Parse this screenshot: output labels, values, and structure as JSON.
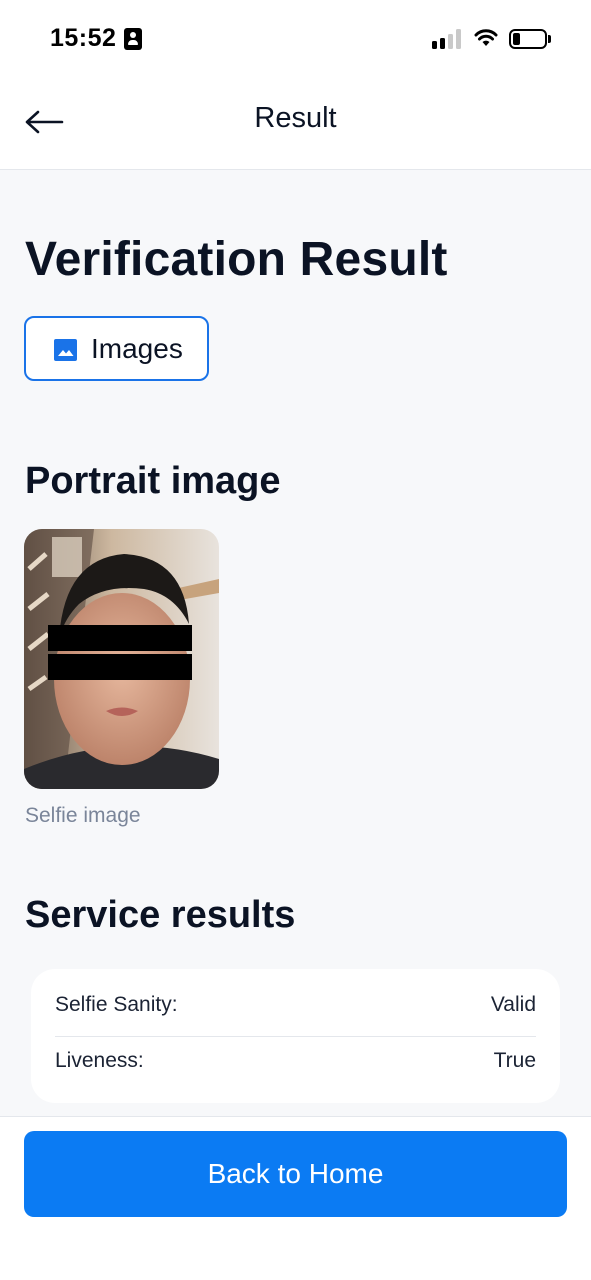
{
  "status_bar": {
    "time": "15:52"
  },
  "header": {
    "title": "Result"
  },
  "main": {
    "title": "Verification Result",
    "images_button_label": "Images",
    "portrait_section_title": "Portrait image",
    "selfie_caption": "Selfie image",
    "service_section_title": "Service results",
    "results": [
      {
        "label": "Selfie Sanity:",
        "value": "Valid"
      },
      {
        "label": "Liveness:",
        "value": "True"
      }
    ]
  },
  "footer": {
    "home_button_label": "Back to Home"
  },
  "colors": {
    "accent": "#0b7bf3",
    "accent_border": "#1a73e8",
    "background": "#f7f8fa"
  },
  "icons": [
    "contact-card-icon",
    "signal-icon",
    "wifi-icon",
    "battery-icon",
    "back-arrow-icon",
    "image-icon"
  ]
}
